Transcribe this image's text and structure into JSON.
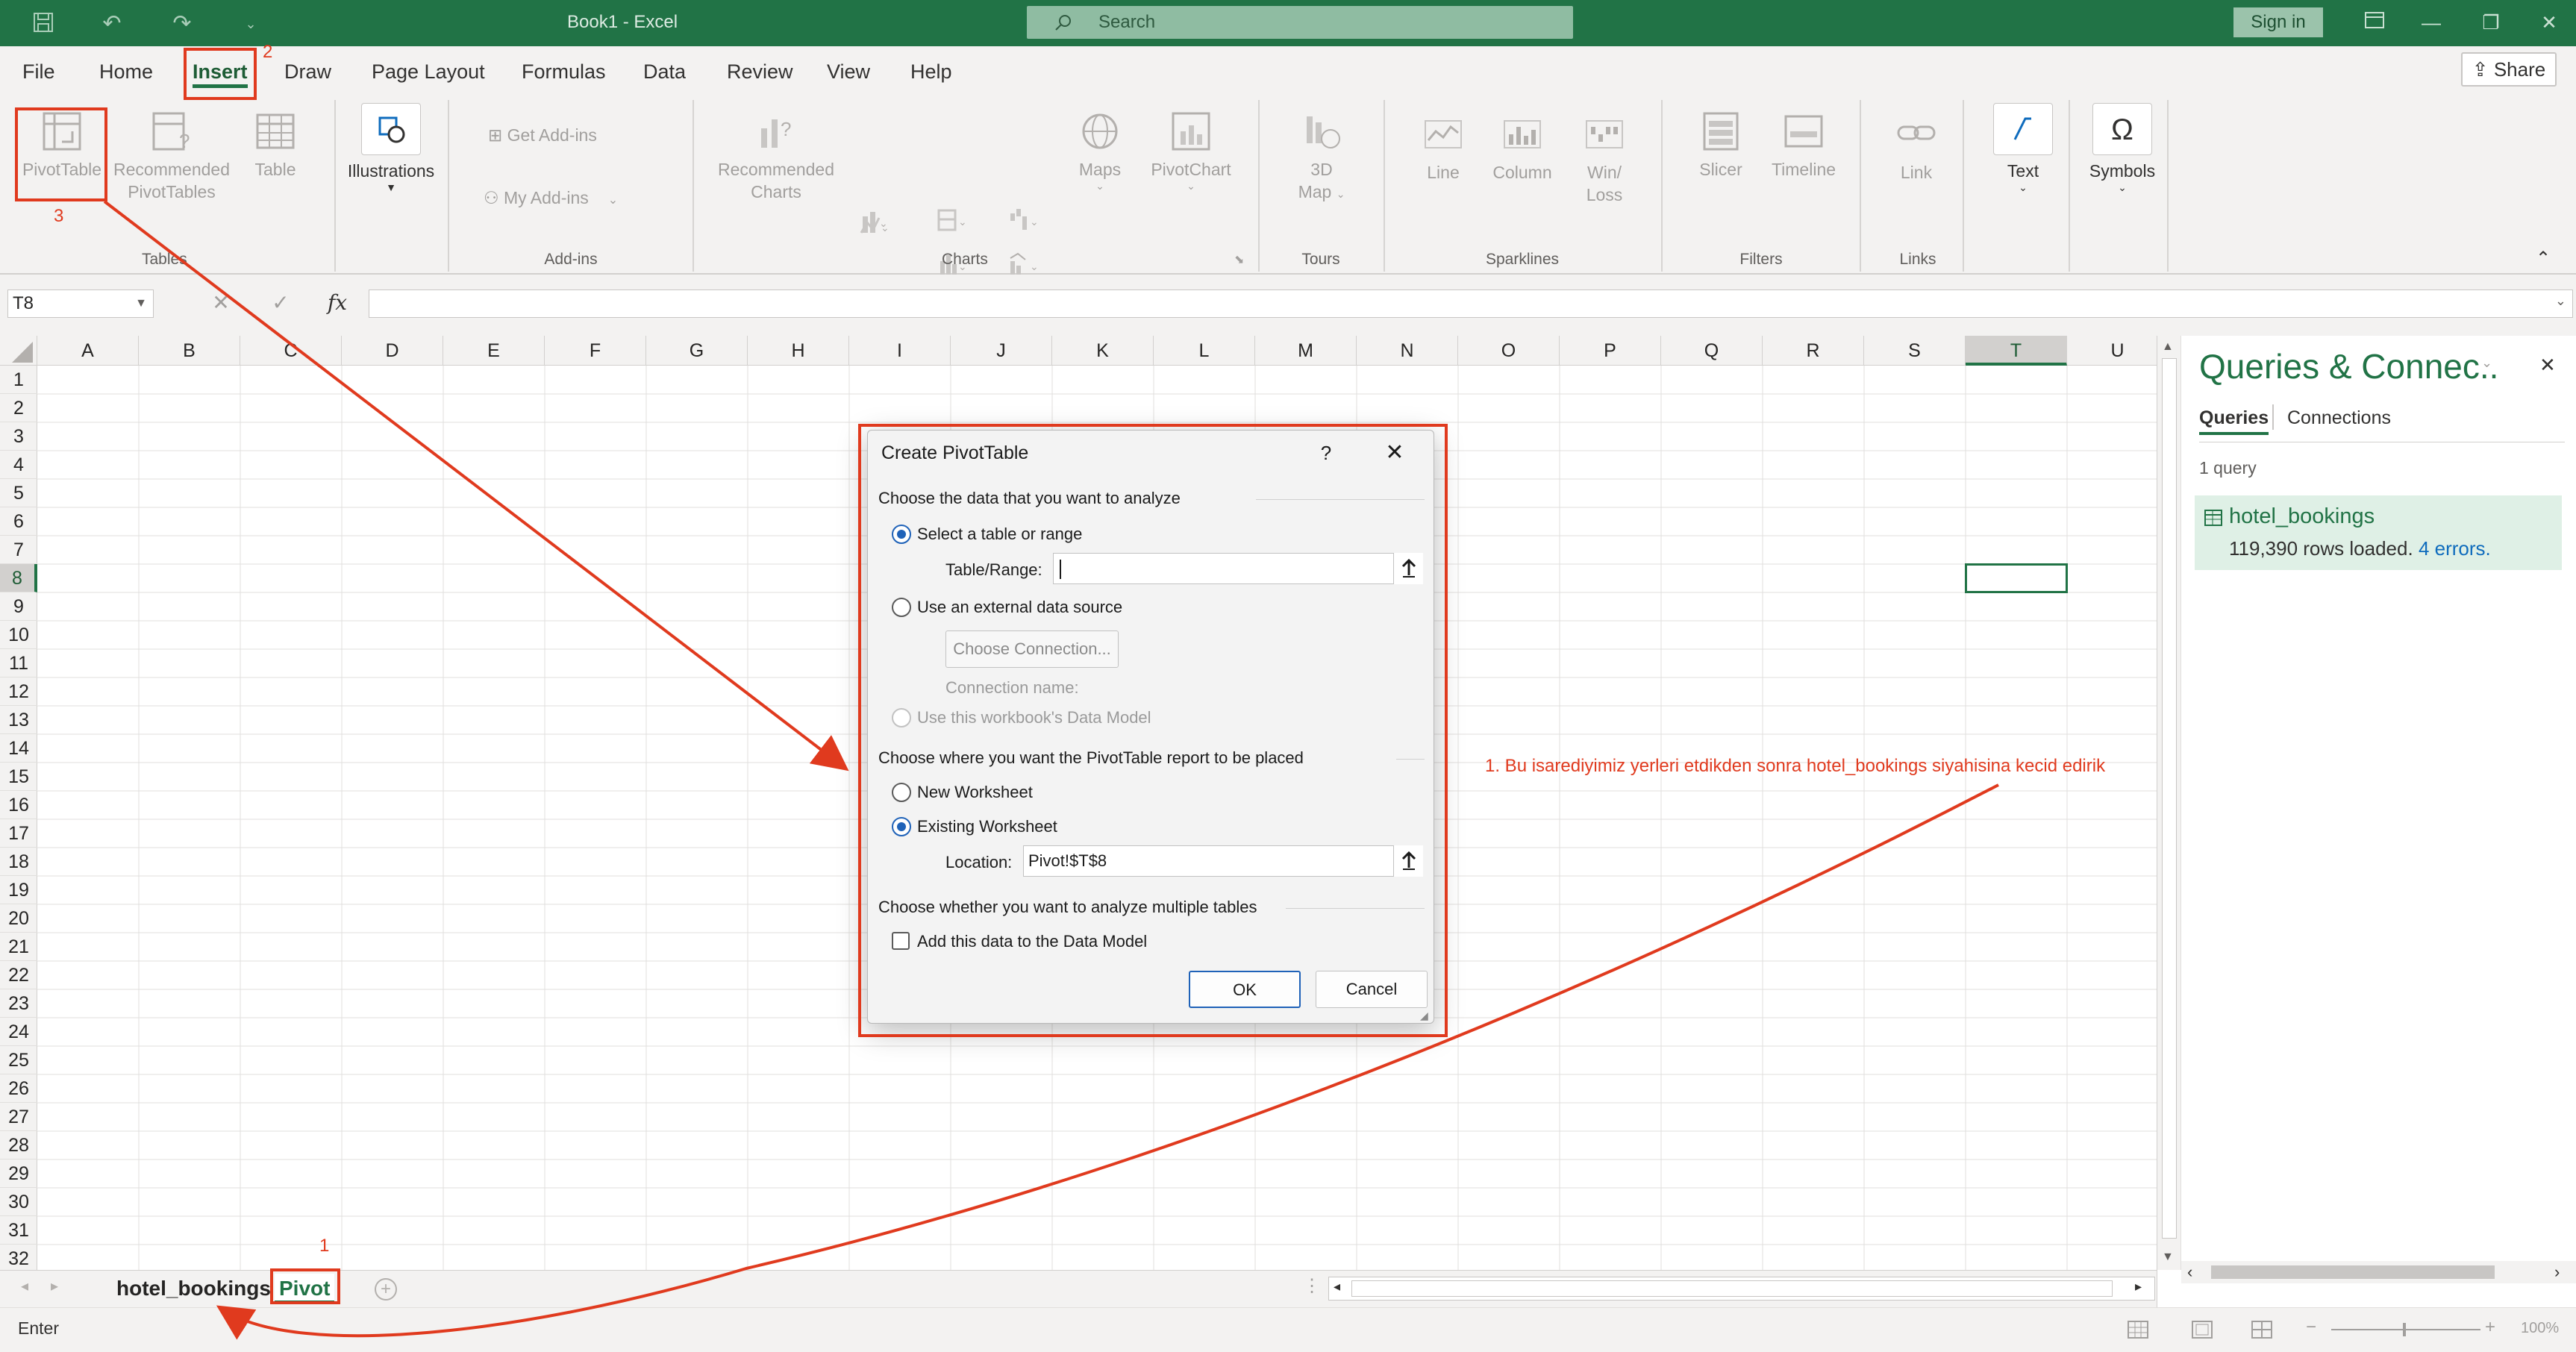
{
  "app": {
    "doc_title": "Book1  -  Excel",
    "search_placeholder": "Search",
    "sign_in": "Sign in"
  },
  "ribbon": {
    "tabs": [
      "File",
      "Home",
      "Insert",
      "Draw",
      "Page Layout",
      "Formulas",
      "Data",
      "Review",
      "View",
      "Help"
    ],
    "active_tab": "Insert",
    "share": "Share",
    "groups": {
      "tables": {
        "label": "Tables",
        "pivottable": "PivotTable",
        "recommended_pivottables": [
          "Recommended",
          "PivotTables"
        ],
        "table": "Table"
      },
      "illustrations": {
        "label": "Illustrations"
      },
      "addins": {
        "label": "Add-ins",
        "get_addins": "Get Add-ins",
        "my_addins": "My Add-ins"
      },
      "charts": {
        "label": "Charts",
        "recommended_charts": [
          "Recommended",
          "Charts"
        ],
        "maps": "Maps",
        "pivotchart": "PivotChart"
      },
      "tours": {
        "label": "Tours",
        "map3d": [
          "3D",
          "Map"
        ]
      },
      "sparklines": {
        "label": "Sparklines",
        "line": "Line",
        "column": "Column",
        "winloss": [
          "Win/",
          "Loss"
        ]
      },
      "filters": {
        "label": "Filters",
        "slicer": "Slicer",
        "timeline": "Timeline"
      },
      "links": {
        "label": "Links",
        "link": "Link"
      },
      "text": {
        "label": "Text"
      },
      "symbols": {
        "label": "Symbols"
      }
    }
  },
  "formula_bar": {
    "name_box": "T8",
    "fx": "fx",
    "value": ""
  },
  "sheet": {
    "columns": [
      "A",
      "B",
      "C",
      "D",
      "E",
      "F",
      "G",
      "H",
      "I",
      "J",
      "K",
      "L",
      "M",
      "N",
      "O",
      "P",
      "Q",
      "R",
      "S",
      "T",
      "U"
    ],
    "rows": [
      "1",
      "2",
      "3",
      "4",
      "5",
      "6",
      "7",
      "8",
      "9",
      "10",
      "11",
      "12",
      "13",
      "14",
      "15",
      "16",
      "17",
      "18",
      "19",
      "20",
      "21",
      "22",
      "23",
      "24",
      "25",
      "26",
      "27",
      "28",
      "29",
      "30",
      "31",
      "32"
    ],
    "selected_cell": "T8",
    "tabs": [
      "hotel_bookings",
      "Pivot"
    ],
    "active_tab": "Pivot"
  },
  "queries_pane": {
    "title": "Queries & Connec..",
    "tabs": [
      "Queries",
      "Connections"
    ],
    "active_tab": "Queries",
    "count": "1 query",
    "query": {
      "name": "hotel_bookings",
      "status_prefix": "119,390 rows loaded.",
      "errors": "4 errors."
    }
  },
  "status_bar": {
    "mode": "Enter",
    "zoom": "100%"
  },
  "dialog": {
    "title": "Create PivotTable",
    "help": "?",
    "section_data": "Choose the data that you want to analyze",
    "opt_table": "Select a table or range",
    "table_range_label": "Table/Range:",
    "table_range_value": "",
    "opt_external": "Use an external data source",
    "choose_connection": "Choose Connection...",
    "connection_name": "Connection name:",
    "opt_datamodel": "Use this workbook's Data Model",
    "section_place": "Choose where you want the PivotTable report to be placed",
    "opt_new_ws": "New Worksheet",
    "opt_existing_ws": "Existing Worksheet",
    "location_label": "Location:",
    "location_value": "Pivot!$T$8",
    "section_multi": "Choose whether you want to analyze multiple tables",
    "add_datamodel": "Add this data to the Data Model",
    "ok": "OK",
    "cancel": "Cancel"
  },
  "annotations": {
    "step1": "1",
    "step2": "2",
    "step3": "3",
    "note": "1. Bu isarediyimiz yerleri etdikden sonra hotel_bookings siyahisina kecid edirik",
    "color": "#e03a1e"
  },
  "colors": {
    "excel_green": "#217346",
    "annotation_red": "#e03a1e"
  }
}
